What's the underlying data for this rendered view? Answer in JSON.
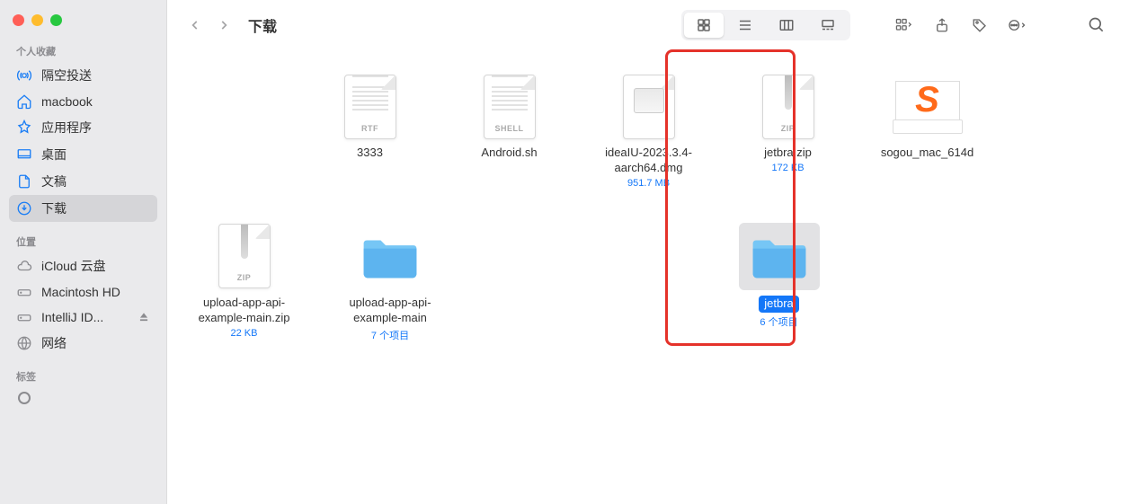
{
  "toolbar": {
    "title": "下载"
  },
  "sidebar": {
    "favorites_label": "个人收藏",
    "favorites": [
      {
        "label": "隔空投送",
        "icon": "airdrop"
      },
      {
        "label": "macbook",
        "icon": "house"
      },
      {
        "label": "应用程序",
        "icon": "apps"
      },
      {
        "label": "桌面",
        "icon": "desktop"
      },
      {
        "label": "文稿",
        "icon": "doc"
      },
      {
        "label": "下载",
        "icon": "download",
        "selected": true
      }
    ],
    "locations_label": "位置",
    "locations": [
      {
        "label": "iCloud 云盘",
        "icon": "cloud"
      },
      {
        "label": "Macintosh HD",
        "icon": "hdd"
      },
      {
        "label": "IntelliJ ID...",
        "icon": "hdd",
        "eject": true
      },
      {
        "label": "网络",
        "icon": "globe"
      }
    ],
    "tags_label": "标签"
  },
  "files": [
    {
      "name": "3333",
      "type": "RTF",
      "meta": ""
    },
    {
      "name": "Android.sh",
      "type": "SHELL",
      "meta": ""
    },
    {
      "name": "ideaIU-2023.3.4-aarch64.dmg",
      "type": "DMG",
      "meta": "951.7 MB"
    },
    {
      "name": "jetbra.zip",
      "type": "ZIP",
      "meta": "172 KB"
    },
    {
      "name": "sogou_mac_614d",
      "type": "SOGOU",
      "meta": ""
    },
    {
      "name": "upload-app-api-example-main.zip",
      "type": "ZIP",
      "meta": "22 KB"
    },
    {
      "name": "upload-app-api-example-main",
      "type": "FOLDER",
      "meta": "7 个项目"
    },
    {
      "name": "jetbra",
      "type": "FOLDER",
      "meta": "6 个项目",
      "selected": true
    }
  ]
}
